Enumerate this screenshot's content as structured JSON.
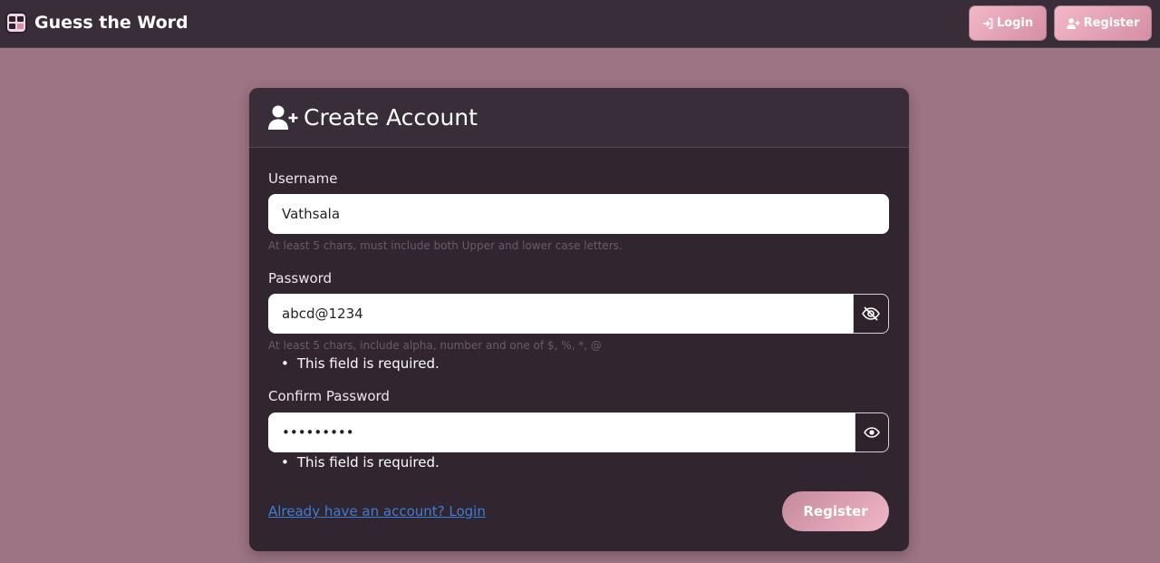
{
  "app": {
    "title": "Guess the Word"
  },
  "nav": {
    "login_label": "Login",
    "register_label": "Register"
  },
  "form": {
    "heading": "Create Account",
    "username": {
      "label": "Username",
      "value": "Vathsala",
      "hint": "At least 5 chars, must include both Upper and lower case letters."
    },
    "password": {
      "label": "Password",
      "value": "abcd@1234",
      "hint": "At least 5 chars, include alpha, number and one of $, %, *, @",
      "error": "This field is required."
    },
    "confirm_password": {
      "label": "Confirm Password",
      "value": "•••••••••",
      "error": "This field is required."
    },
    "login_link": "Already have an account? Login",
    "submit_label": "Register"
  },
  "icons": {
    "brand": "grid-logo-icon",
    "login": "sign-in-icon",
    "register": "user-plus-icon",
    "password_toggle": "eye-slash-icon",
    "confirm_toggle": "eye-icon"
  },
  "colors": {
    "background": "#9c7483",
    "navbar": "#392d3a",
    "card": "#31252f",
    "accent": "#f3b9c8",
    "link": "#3c7dd8"
  }
}
